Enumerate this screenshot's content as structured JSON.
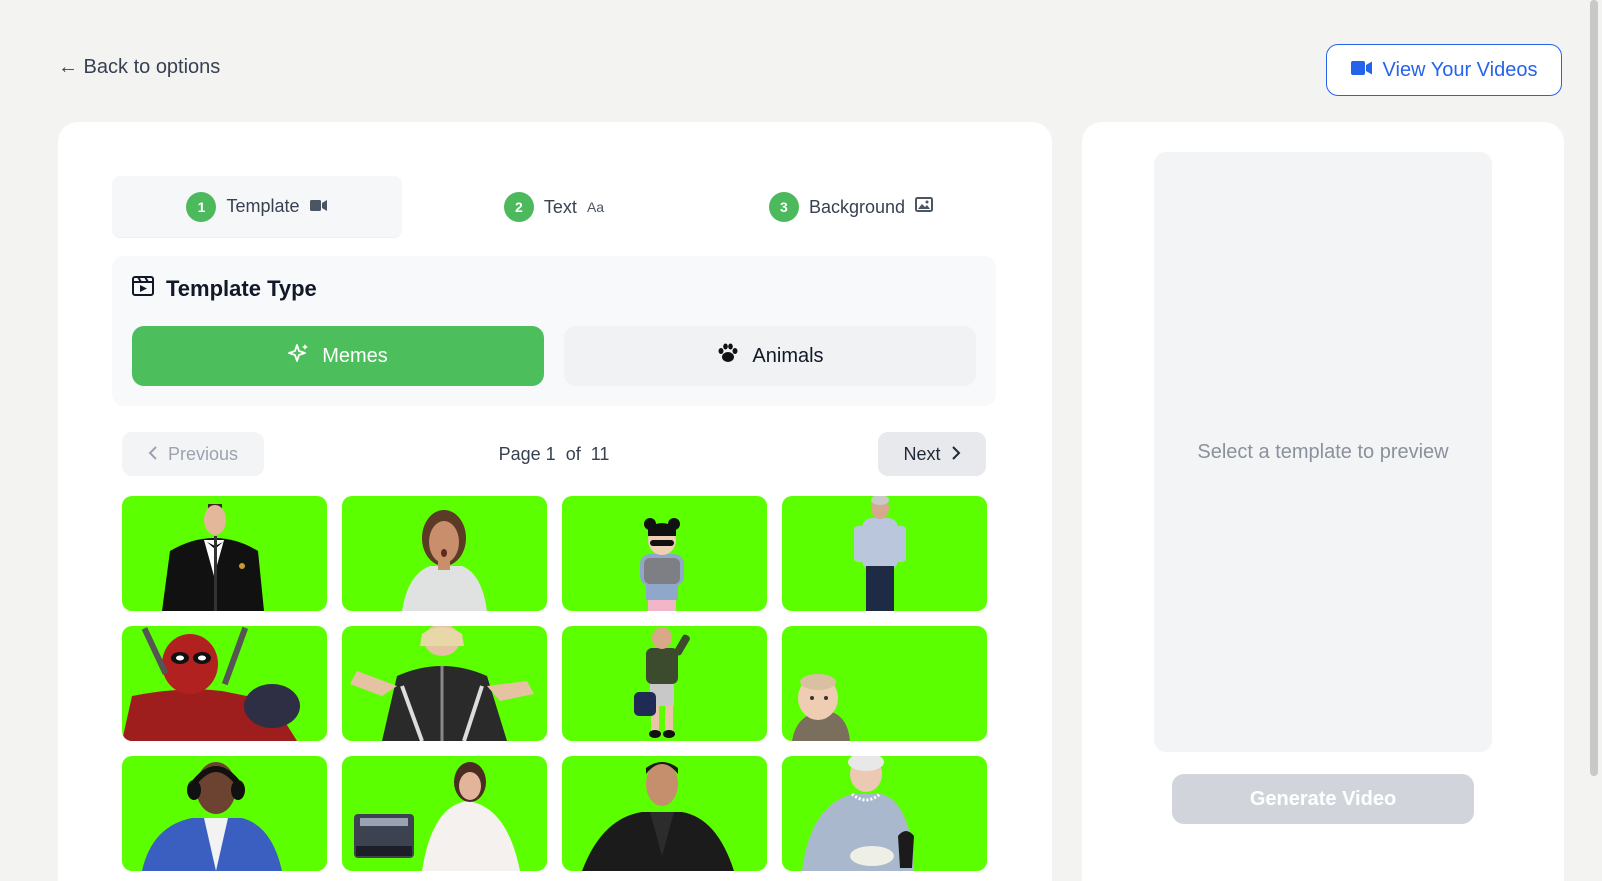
{
  "header": {
    "back_label": "← Back to options",
    "view_videos_label": "View Your Videos"
  },
  "steps": [
    {
      "num": "1",
      "label": "Template",
      "icon": "video-camera-icon"
    },
    {
      "num": "2",
      "label": "Text",
      "icon": "font-aa-icon",
      "icon_text": "Aa"
    },
    {
      "num": "3",
      "label": "Background",
      "icon": "image-icon"
    }
  ],
  "template_type": {
    "title": "Template Type",
    "options": [
      {
        "label": "Memes",
        "icon": "sparkle-icon",
        "selected": true
      },
      {
        "label": "Animals",
        "icon": "paw-icon",
        "selected": false
      }
    ]
  },
  "pagination": {
    "previous_label": "Previous",
    "next_label": "Next",
    "page_label": "Page",
    "current": "1",
    "of_label": "of",
    "total": "11"
  },
  "templates": [
    {
      "name": "man in tuxedo at microphone"
    },
    {
      "name": "surprised woman in grey sweater"
    },
    {
      "name": "girl in sunglasses"
    },
    {
      "name": "man in light blue shirt"
    },
    {
      "name": "masked red hero"
    },
    {
      "name": "woman in black jacket shrugging"
    },
    {
      "name": "boy with bag"
    },
    {
      "name": "baby"
    },
    {
      "name": "man with headphones in blue suit"
    },
    {
      "name": "woman in fur with printer"
    },
    {
      "name": "man in black suit"
    },
    {
      "name": "elderly woman with pearls"
    }
  ],
  "preview": {
    "placeholder": "Select a template to preview",
    "generate_label": "Generate Video"
  },
  "colors": {
    "accent_green": "#4cbe5c",
    "chroma_green": "#5cff00",
    "link_blue": "#2563eb"
  }
}
